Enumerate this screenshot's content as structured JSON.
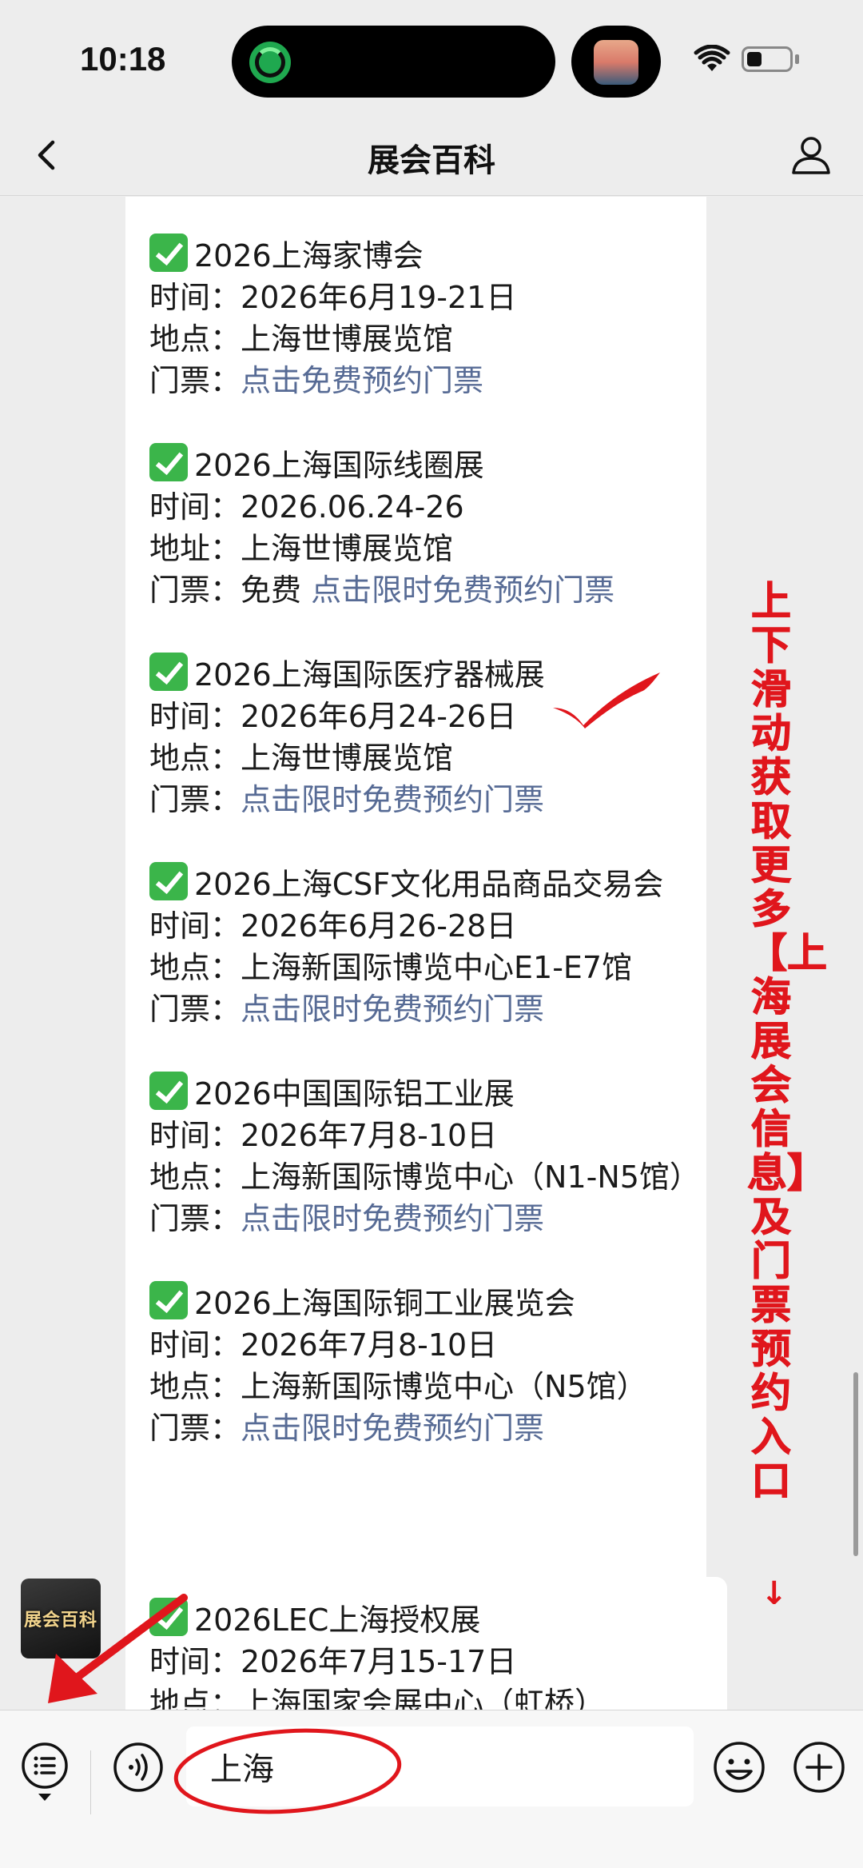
{
  "status_bar": {
    "time": "10:18",
    "icons": [
      "activity-island-icon",
      "media-thumbnail-icon",
      "wifi-icon",
      "battery-icon"
    ]
  },
  "nav": {
    "title": "展会百科",
    "back_icon": "chevron-left-icon",
    "profile_icon": "person-icon"
  },
  "entries": [
    {
      "title": "2026上海家博会",
      "lines": [
        {
          "label": "时间：",
          "value": "2026年6月19-21日"
        },
        {
          "label": "地点：",
          "value": "上海世博展览馆"
        }
      ],
      "ticket_label": "门票：",
      "ticket_prefix": "",
      "ticket_link": "点击免费预约门票"
    },
    {
      "title": "2026上海国际线圈展",
      "lines": [
        {
          "label": "时间：",
          "value": "2026.06.24-26"
        },
        {
          "label": "地址：",
          "value": "上海世博展览馆"
        }
      ],
      "ticket_label": "门票：",
      "ticket_prefix": "免费 ",
      "ticket_link": "点击限时免费预约门票"
    },
    {
      "title": "2026上海国际医疗器械展",
      "lines": [
        {
          "label": "时间：",
          "value": "2026年6月24-26日"
        },
        {
          "label": "地点：",
          "value": "上海世博展览馆"
        }
      ],
      "ticket_label": "门票：",
      "ticket_prefix": "",
      "ticket_link": "点击限时免费预约门票"
    },
    {
      "title": "2026上海CSF文化用品商品交易会",
      "lines": [
        {
          "label": "时间：",
          "value": "2026年6月26-28日"
        },
        {
          "label": "地点：",
          "value": "上海新国际博览中心E1-E7馆"
        }
      ],
      "ticket_label": "门票：",
      "ticket_prefix": "",
      "ticket_link": "点击限时免费预约门票"
    },
    {
      "title": "2026中国国际铝工业展",
      "lines": [
        {
          "label": "时间：",
          "value": "2026年7月8-10日"
        },
        {
          "label": "地点：",
          "value": "上海新国际博览中心（N1-N5馆）"
        }
      ],
      "ticket_label": "门票：",
      "ticket_prefix": "",
      "ticket_link": "点击限时免费预约门票"
    },
    {
      "title": "2026上海国际铜工业展览会",
      "lines": [
        {
          "label": "时间：",
          "value": "2026年7月8-10日"
        },
        {
          "label": "地点：",
          "value": "上海新国际博览中心（N5馆）"
        }
      ],
      "ticket_label": "门票：",
      "ticket_prefix": "",
      "ticket_link": "点击限时免费预约门票"
    }
  ],
  "next_message": {
    "avatar_text": "展会百科",
    "title": "2026LEC上海授权展",
    "lines": [
      {
        "label": "时间：",
        "value": "2026年7月15-17日"
      },
      {
        "label": "地点：",
        "value": "上海国家会展中心（虹桥）"
      }
    ]
  },
  "overlay": {
    "vertical_text": "上下滑动获取更多【上海展会信息】及门票预约入口",
    "arrow": "↓",
    "color": "#e0161c"
  },
  "input_bar": {
    "value": "上海",
    "menu_icon": "list-menu-icon",
    "voice_icon": "voice-icon",
    "emoji_icon": "emoji-icon",
    "plus_icon": "plus-icon"
  },
  "colors": {
    "link": "#576b95",
    "check": "#3bb54a",
    "background": "#ededed"
  }
}
